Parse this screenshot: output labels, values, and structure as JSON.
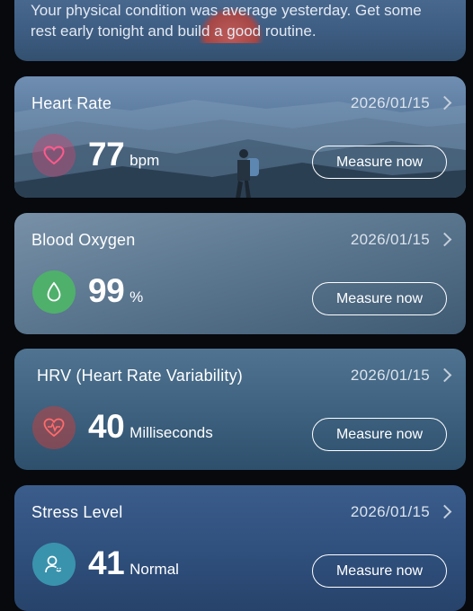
{
  "summary": {
    "text": "Your physical condition was average yesterday. Get some rest early tonight and build a good routine."
  },
  "metrics": [
    {
      "title": "Heart Rate",
      "date": "2026/01/15",
      "value": "77",
      "unit": "bpm",
      "button": "Measure now",
      "icon": "heart-icon",
      "accent": "#d94f86"
    },
    {
      "title": "Blood Oxygen",
      "date": "2026/01/15",
      "value": "99",
      "unit": "%",
      "button": "Measure now",
      "icon": "droplet-icon",
      "accent": "#4fb06b"
    },
    {
      "title": "HRV (Heart Rate Variability)",
      "date": "2026/01/15",
      "value": "40",
      "unit": "Milliseconds",
      "button": "Measure now",
      "icon": "heart-pulse-icon",
      "accent": "#e05656"
    },
    {
      "title": "Stress Level",
      "date": "2026/01/15",
      "value": "41",
      "unit": "Normal",
      "button": "Measure now",
      "icon": "person-mood-icon",
      "accent": "#3a93ad"
    }
  ]
}
